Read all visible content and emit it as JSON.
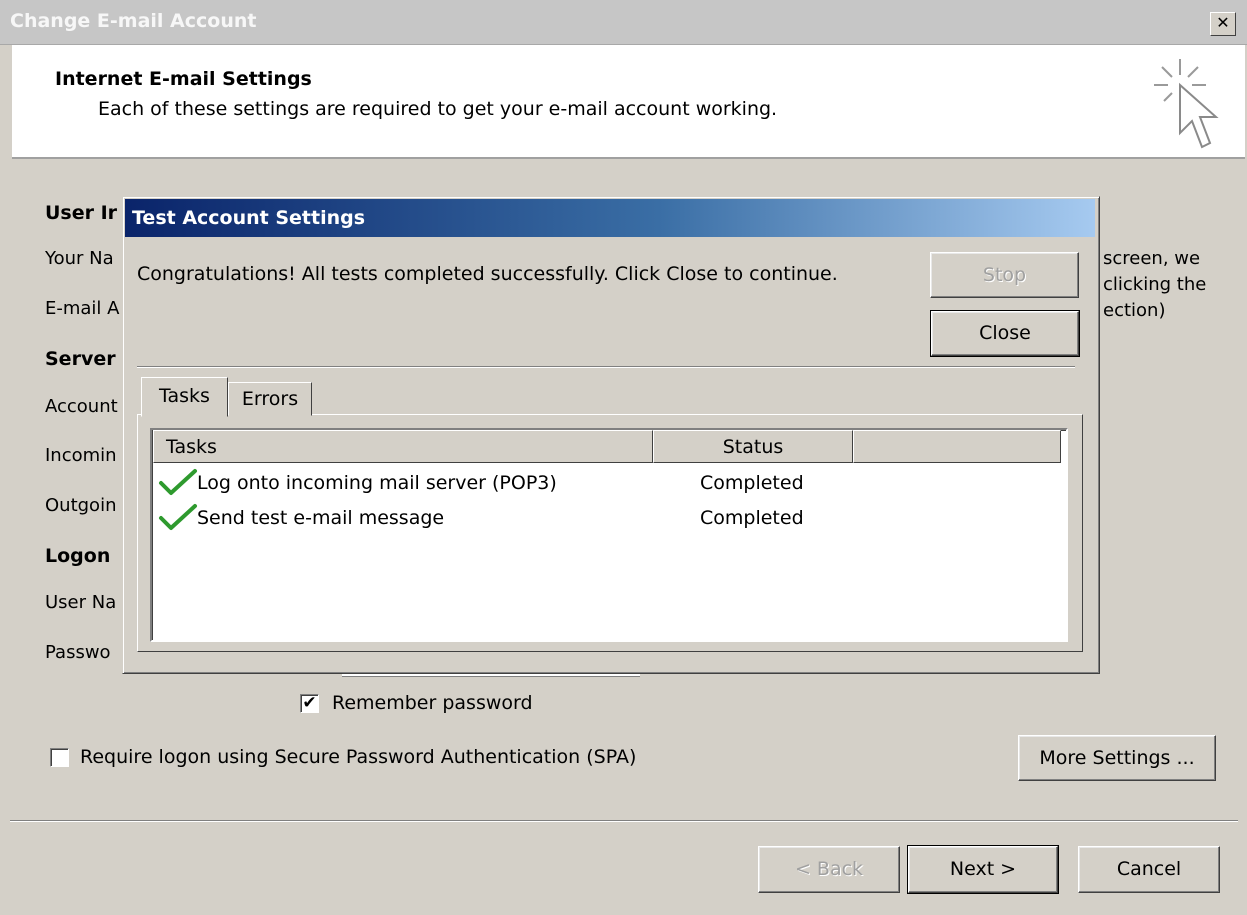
{
  "window": {
    "title": "Change E-mail Account",
    "close_label": "✕"
  },
  "header": {
    "title": "Internet E-mail Settings",
    "subtitle": "Each of these settings are required to get your e-mail account working."
  },
  "background": {
    "user_info_heading": "User Ir",
    "your_name_label": "Your Na",
    "email_label": "E-mail A",
    "server_heading": "Server",
    "account_label": "Account",
    "incoming_label": "Incomin",
    "outgoing_label": "Outgoin",
    "logon_heading": "Logon",
    "username_label": "User Na",
    "password_label": "Passwo",
    "right_text_1": "screen, we",
    "right_text_2": "clicking the",
    "right_text_3": "ection)",
    "remember_password_label": "Remember password",
    "remember_password_checked": true,
    "spa_label": "Require logon using Secure Password Authentication (SPA)",
    "spa_checked": false,
    "more_settings_label": "More Settings ..."
  },
  "footer": {
    "back_label": "< Back",
    "next_label": "Next >",
    "cancel_label": "Cancel"
  },
  "modal": {
    "title": "Test Account Settings",
    "message": "Congratulations! All tests completed successfully. Click Close to continue.",
    "stop_label": "Stop",
    "close_label": "Close",
    "tabs": [
      {
        "label": "Tasks"
      },
      {
        "label": "Errors"
      }
    ],
    "columns": {
      "tasks": "Tasks",
      "status": "Status"
    },
    "rows": [
      {
        "task": "Log onto incoming mail server (POP3)",
        "status": "Completed"
      },
      {
        "task": "Send test e-mail message",
        "status": "Completed"
      }
    ]
  },
  "colors": {
    "title_bar": "#c6c6c6",
    "modal_title_start": "#0a246a",
    "modal_title_end": "#a6caf0",
    "check_green": "#2e9a2e",
    "dialog_face": "#d4d0c8"
  },
  "icons": {
    "header_icon": "cursor-sparkle-icon",
    "check": "checkmark-icon"
  }
}
